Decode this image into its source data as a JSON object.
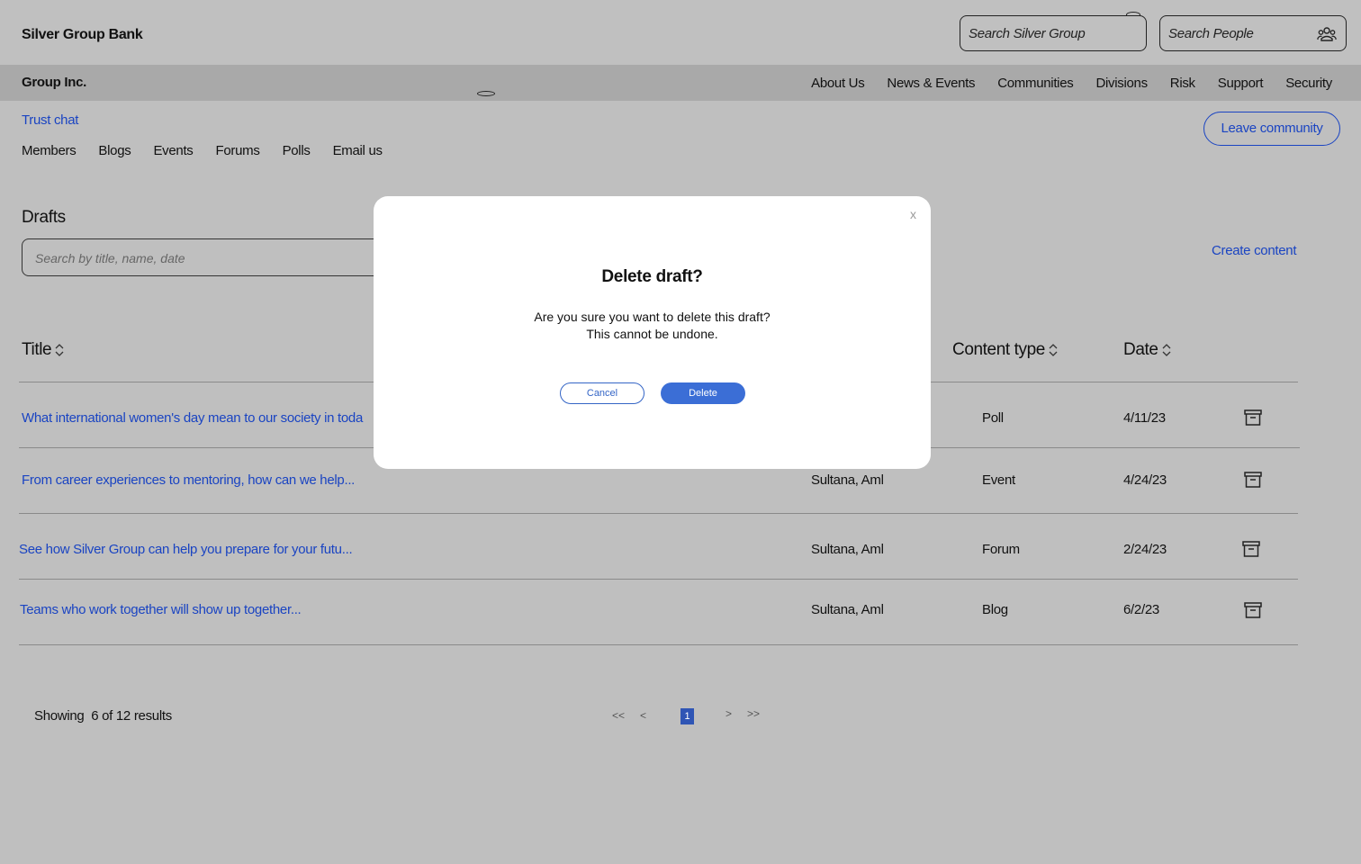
{
  "header": {
    "brand": "Silver Group Bank",
    "search_group_placeholder": "Search Silver Group",
    "search_people_placeholder": "Search People"
  },
  "nav": {
    "company": "Group Inc.",
    "links": [
      "About Us",
      "News & Events",
      "Communities",
      "Divisions",
      "Risk",
      "Support",
      "Security"
    ]
  },
  "community": {
    "trust_chat": "Trust chat",
    "leave_label": "Leave community",
    "tabs": [
      "Members",
      "Blogs",
      "Events",
      "Forums",
      "Polls",
      "Email us"
    ]
  },
  "drafts": {
    "title": "Drafts",
    "search_placeholder": "Search by title, name, date",
    "create_label": "Create content",
    "columns": {
      "title": "Title",
      "content_type": "Content type",
      "date": "Date"
    },
    "rows": [
      {
        "title": "What international women's day mean to our society in toda",
        "author": "",
        "type": "Poll",
        "date": "4/11/23"
      },
      {
        "title": "From career experiences to mentoring, how can we help...",
        "author": "Sultana, Aml",
        "type": "Event",
        "date": "4/24/23"
      },
      {
        "title": "See how Silver Group can help you prepare for your futu...",
        "author": "Sultana, Aml",
        "type": "Forum",
        "date": "2/24/23"
      },
      {
        "title": "Teams who work together will show up together...",
        "author": "Sultana, Aml",
        "type": "Blog",
        "date": "6/2/23"
      }
    ],
    "showing_label": "Showing",
    "showing_count": "6 of 12 results"
  },
  "pagination": {
    "first": "<<",
    "prev": "<",
    "current": "1",
    "next": ">",
    "last": ">>"
  },
  "modal": {
    "close": "x",
    "title": "Delete draft?",
    "message_line1": "Are you sure you want to delete this draft?",
    "message_line2": "This cannot be undone.",
    "cancel_label": "Cancel",
    "delete_label": "Delete"
  },
  "colors": {
    "link": "#1a44c2",
    "primary_button": "#3b6ed6",
    "page_bg": "#bfbfbf",
    "nav_bg": "#a9a9a9"
  }
}
